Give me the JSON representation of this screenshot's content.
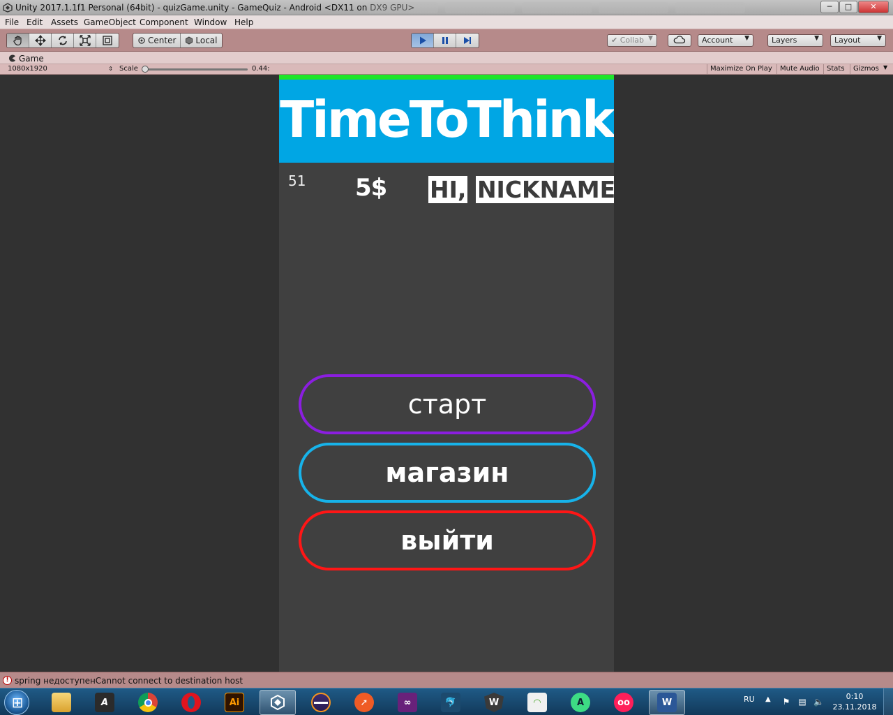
{
  "window": {
    "title": "Unity 2017.1.1f1 Personal (64bit) - quizGame.unity - GameQuiz - Android <DX11 on DX9 GPU>",
    "min_label": "─",
    "max_label": "□",
    "close_label": "✕"
  },
  "menu": [
    "File",
    "Edit",
    "Assets",
    "GameObject",
    "Component",
    "Window",
    "Help"
  ],
  "toolbar": {
    "transform_tools": [
      "hand-icon",
      "move-icon",
      "rotate-icon",
      "scale-icon",
      "rect-tool-icon"
    ],
    "pivot_center": "Center",
    "pivot_local": "Local",
    "collab": "Collab",
    "account": "Account",
    "layers": "Layers",
    "layout": "Layout"
  },
  "game_tab": {
    "label": "Game",
    "resolution": "1080x1920",
    "scale_label": "Scale",
    "scale_value": "0.44:",
    "scale_level": 0.0,
    "maximize_on_play": "Maximize On Play",
    "mute_audio": "Mute Audio",
    "stats": "Stats",
    "gizmos": "Gizmos"
  },
  "game": {
    "title": "TimeToThink",
    "counter": "51",
    "money": "5$",
    "greeting_hi": "HI,",
    "greeting_name": "NICKNAME",
    "buttons": {
      "start": "старт",
      "shop": "магазин",
      "quit": "выйти"
    },
    "colors": {
      "header": "#00a6e4",
      "strip": "#1fe62a",
      "start_border": "#8b1ee0",
      "shop_border": "#17b3ea",
      "quit_border": "#ff1616"
    }
  },
  "status": {
    "message": "spring недоступенCannot connect to destination host"
  },
  "taskbar": {
    "apps": [
      "explorer-icon",
      "autodesk-icon",
      "chrome-icon",
      "opera-icon",
      "illustrator-icon",
      "unity-icon",
      "eclipse-icon",
      "postman-icon",
      "visual-studio-icon",
      "mysql-workbench-icon",
      "world-of-tanks-icon",
      "wifi-tool-icon",
      "android-studio-icon",
      "flickr-icon",
      "word-icon"
    ],
    "illustrator_label": "Ai",
    "word_label": "W",
    "language": "RU",
    "time": "0:10",
    "date": "23.11.2018"
  }
}
